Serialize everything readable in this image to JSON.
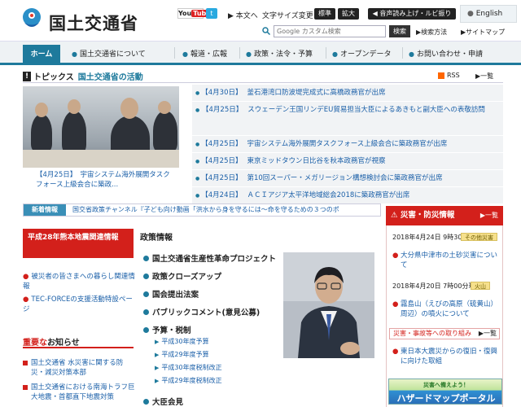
{
  "header": {
    "site_name": "国土交通省",
    "youtube_you": "You",
    "youtube_tube": "Tube",
    "twitter": "t",
    "text_only": "本文へ",
    "font_size_label": "文字サイズ変更",
    "font_standard": "標準",
    "font_large": "拡大",
    "read_aloud": "音声読み上げ・ルビ振り",
    "english": "English",
    "search_placeholder": "Google カスタム検索",
    "search_button": "検索",
    "search_method": "検索方法",
    "sitemap": "サイトマップ"
  },
  "nav": {
    "home": "ホーム",
    "items": [
      "国土交通省について",
      "報道・広報",
      "政策・法令・予算",
      "オープンデータ",
      "お問い合わせ・申請"
    ]
  },
  "topics": {
    "title": "トピックス",
    "subtitle": "国土交通省の活動",
    "rss": "RSS",
    "list": "一覧",
    "photo_caption": "【4月25日】　宇宙システム海外展開タスクフォース上級会合に築政...",
    "items": [
      {
        "date": "【4月30日】",
        "text": "釜石港湾口防波堤完成式に高橋政務官が出席"
      },
      {
        "date": "【4月25日】",
        "text": "スウェーデン王国リンデEU貿易担当大臣によるあきもと副大臣への表敬訪問"
      },
      {
        "date": "【4月25日】",
        "text": "宇宙システム海外展開タスクフォース上級会合に築政務官が出席"
      },
      {
        "date": "【4月25日】",
        "text": "東京ミッドタウン日比谷を秋本政務官が視察"
      },
      {
        "date": "【4月25日】",
        "text": "第10回スーパー・メガリージョン構想検討会に築政務官が出席"
      },
      {
        "date": "【4月24日】",
        "text": "ＡＣＩアジア太平洋地域総会2018に築政務官が出席"
      }
    ]
  },
  "news": {
    "tag": "新着情報",
    "text": "国交省政策チャンネル『子ども向け動画「洪水から身を守るには～命を守るための３つのポ"
  },
  "left": {
    "kumamoto": "平成28年熊本地震関連情報",
    "links": [
      "被災者の皆さまへの暮らし関連情報",
      "TEC-FORCEの支援活動特設ページ"
    ],
    "important_head_1": "重要な",
    "important_head_2": "お知らせ",
    "important_links": [
      "国土交通省 水災害に関する防災・減災対策本部",
      "国土交通省における南海トラフ巨大地震・首都直下地震対策"
    ]
  },
  "policy": {
    "title": "政策情報",
    "items": [
      "国土交通省生産性革命プロジェクト",
      "政策クローズアップ",
      "国会提出法案",
      "パブリックコメント(意見公募)",
      "予算・税制"
    ],
    "sub_items": [
      "平成30年度予算",
      "平成29年度予算",
      "平成30年度税制改正",
      "平成29年度税制改正"
    ],
    "bottom_item": "大臣会見"
  },
  "disaster": {
    "title": "災害・防災情報",
    "all": "一覧",
    "entries": [
      {
        "date": "2018年4月24日 9時30分現在",
        "badge": "その他災害",
        "text": "大分県中津市の土砂災害について"
      },
      {
        "date": "2018年4月20日 7時00分現在",
        "badge": "火山",
        "text": "霧島山（えびの高原（硫黄山）周辺）の噴火について"
      }
    ],
    "sub_head": "災害・事故等への取り組み",
    "sub_all": "一覧",
    "sub_link": "東日本大震災からの復旧・復興に向けた取組",
    "hazard_top": "災害へ備えよう！",
    "hazard_main": "ハザードマップポータル"
  },
  "colors": {
    "accent": "#1e7a9c",
    "alert": "#d3201b",
    "link": "#1a5fa8"
  }
}
